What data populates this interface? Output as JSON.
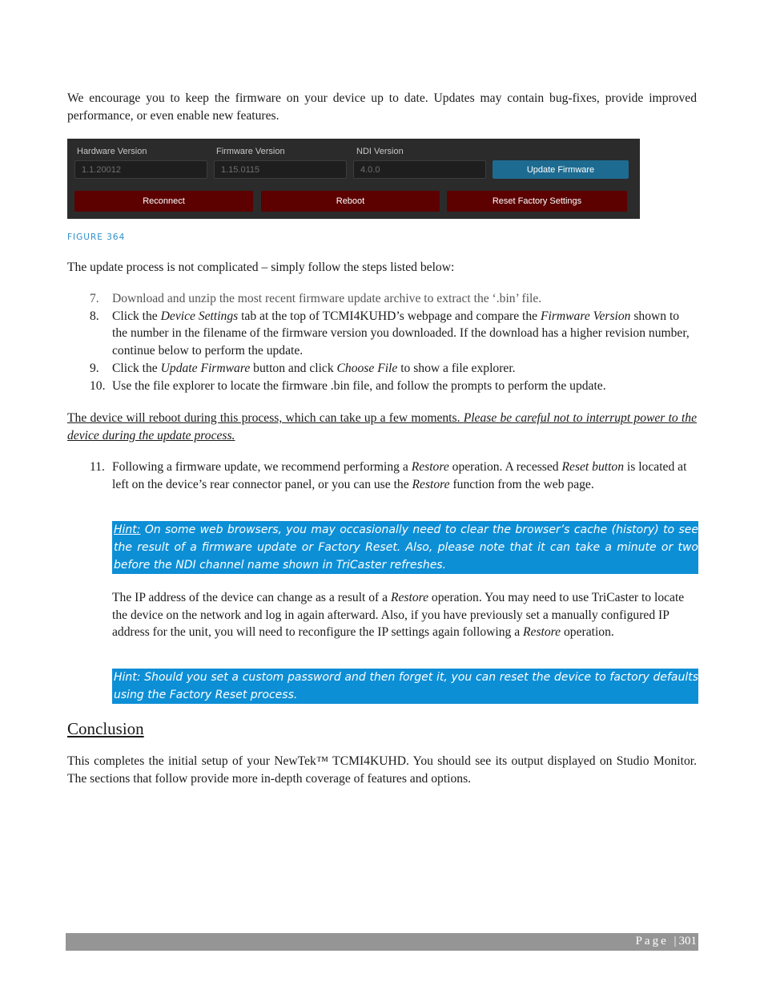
{
  "intro": "We encourage you to keep the firmware on your device up to date. Updates may contain bug-fixes, provide improved performance, or even enable new features.",
  "figure": {
    "fields": [
      {
        "label": "Hardware Version",
        "value": "1.1.20012"
      },
      {
        "label": "Firmware Version",
        "value": "1.15.0115"
      },
      {
        "label": "NDI Version",
        "value": "4.0.0"
      }
    ],
    "update_button": "Update Firmware",
    "reconnect_button": "Reconnect",
    "reboot_button": "Reboot",
    "reset_button": "Reset Factory Settings",
    "caption": "FIGURE 364",
    "colors": {
      "panel": "#2b2b2b",
      "blue_button": "#1d6b91",
      "red_button": "#5c0000"
    }
  },
  "steps_intro": "The update process is not complicated – simply follow the steps listed below:",
  "steps": [
    {
      "num": "7.",
      "parts": [
        "Download and unzip the most recent firmware update archive to extract the ‘.bin’ file."
      ]
    },
    {
      "num": "8.",
      "a": "Click the ",
      "b": "Device Settings",
      "c": " tab at the top of TCMI4KUHD’s webpage and compare the ",
      "d": "Firmware Version",
      "e": " shown to the number in the filename of the firmware version you downloaded.  If the download has a higher revision number, continue below to perform the update."
    },
    {
      "num": "9.",
      "a": "Click the ",
      "b": "Update Firmware",
      "c": " button and click ",
      "d": "Choose File",
      "e": " to show a file explorer."
    },
    {
      "num": "10.",
      "text": "Use the file explorer to locate the firmware .bin file, and follow the prompts to perform the update."
    }
  ],
  "warning": {
    "normal": "The device will reboot during this process, which can take up a few moments.  ",
    "italic": "Please be careful not to interrupt power to the device during the update process."
  },
  "step11": {
    "num": "11.",
    "a": "Following a firmware update, we recommend performing a ",
    "b": "Restore",
    "c": " operation. A recessed ",
    "d": "Reset button",
    "e": " is located at left on the device’s rear connector panel, or you can use the ",
    "f": "Restore",
    "g": " function from the web page."
  },
  "hint1": {
    "label": "Hint:",
    "text": " On some web browsers, you may occasionally need to clear the browser’s cache (history) to see the result of a firmware update or Factory Reset.  Also, please note that it can take a minute or two before the NDI channel name shown in TriCaster refreshes."
  },
  "ip_para": {
    "a": "The IP address of the device can change as a result of a ",
    "b": "Restore",
    "c": " operation.  You may need to use TriCaster to locate the device on the network and log in again afterward.  Also, if you have previously set a manually configured IP address for the unit, you will need to reconfigure the IP settings again following a ",
    "d": "Restore",
    "e": " operation."
  },
  "hint2": "Hint: Should you set a custom password and then forget it, you can reset the device to factory defaults using the Factory Reset process.",
  "heading": "Conclusion",
  "conclusion": "This completes the initial setup of your NewTek™ TCMI4KUHD.  You should see its output displayed on Studio Monitor.  The sections that follow provide more in-depth coverage of features and options.",
  "footer": {
    "label": "Page |",
    "number": "301"
  }
}
